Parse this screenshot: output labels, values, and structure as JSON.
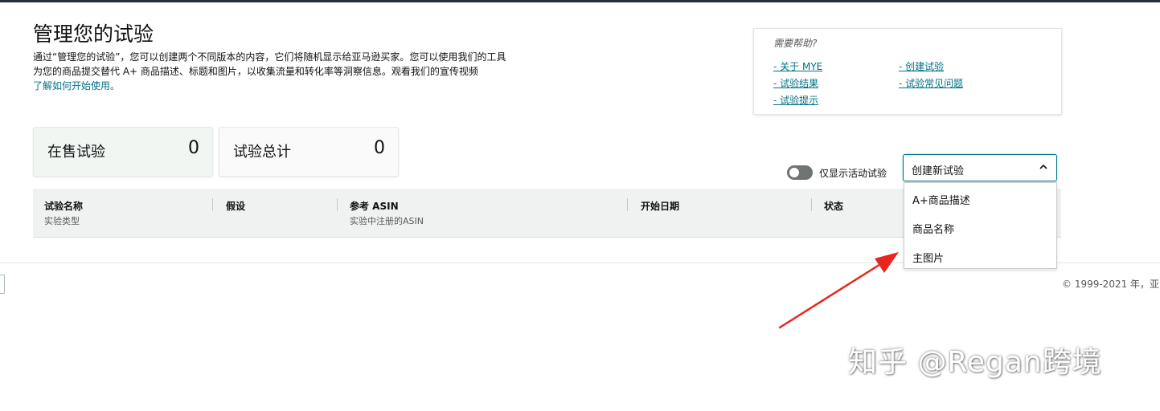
{
  "page": {
    "title": "管理您的试验",
    "intro_line1": "通过“管理您的试验”，您可以创建两个不同版本的内容，它们将随机显示给亚马逊买家。您可以使用我们的工具",
    "intro_line2": "为您的商品提交替代 A+ 商品描述、标题和图片，以收集流量和转化率等洞察信息。观看我们的宣传视频",
    "intro_link": "了解如何开始使用。"
  },
  "help": {
    "title": "需要帮助?",
    "links": [
      "- 关于 MYE",
      "- 创建试验",
      "- 试验结果",
      "- 试验常见问题",
      "- 试验提示"
    ]
  },
  "stats": [
    {
      "label": "在售试验",
      "value": "0"
    },
    {
      "label": "试验总计",
      "value": "0"
    }
  ],
  "filter": {
    "toggle_label": "仅显示活动试验",
    "toggle_on": false
  },
  "create_select": {
    "value": "创建新试验",
    "options": [
      "A+商品描述",
      "商品名称",
      "主图片"
    ]
  },
  "table": {
    "columns": [
      {
        "title": "试验名称",
        "subtitle": "实验类型"
      },
      {
        "title": "假设",
        "subtitle": ""
      },
      {
        "title": "参考 ASIN",
        "subtitle": "实验中注册的ASIN"
      },
      {
        "title": "开始日期",
        "subtitle": ""
      },
      {
        "title": "状态",
        "subtitle": ""
      }
    ]
  },
  "footer": {
    "copyright": "© 1999-2021 年，亚"
  },
  "watermark": "知乎 @Regan跨境",
  "colors": {
    "link": "#007185",
    "header_bg": "#f0f2f2",
    "annotation_arrow": "#e8251f",
    "topbar": "#232f3e"
  }
}
